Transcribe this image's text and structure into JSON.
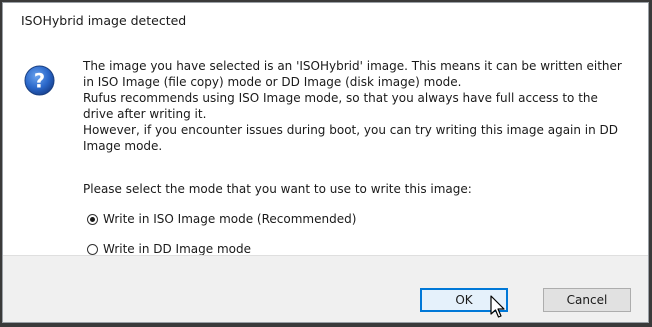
{
  "dialog": {
    "title": "ISOHybrid image detected",
    "icon": "question-icon",
    "message_lines": [
      "The image you have selected is an 'ISOHybrid' image. This means it can be written either",
      "in ISO Image (file copy) mode or DD Image (disk image) mode.",
      "Rufus recommends using ISO Image mode, so that you always have full access to the",
      "drive after writing it.",
      "However, if you encounter issues during boot, you can try writing this image again in DD",
      "Image mode."
    ],
    "prompt": "Please select the mode that you want to use to write this image:",
    "options": [
      {
        "label": "Write in ISO Image mode (Recommended)",
        "selected": true
      },
      {
        "label": "Write in DD Image mode",
        "selected": false
      }
    ],
    "buttons": {
      "ok": "OK",
      "cancel": "Cancel"
    }
  },
  "colors": {
    "icon_blue": "#1f5fbf",
    "focus_border": "#0078d7"
  }
}
